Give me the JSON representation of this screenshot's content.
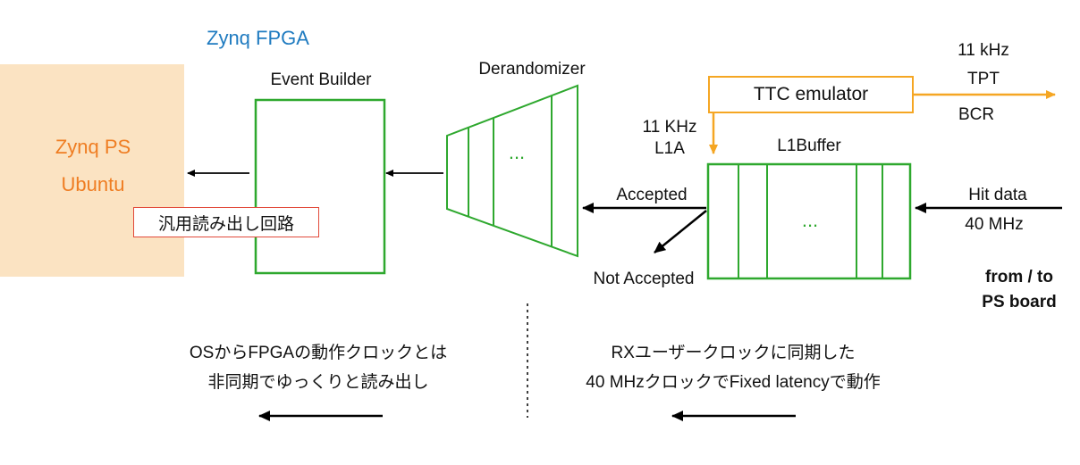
{
  "fpga_title": "Zynq FPGA",
  "zynq_ps": {
    "line1": "Zynq PS",
    "line2": "Ubuntu"
  },
  "readout_circuit": "汎用読み出し回路",
  "event_builder": {
    "label": "Event Builder"
  },
  "derandomizer": {
    "label": "Derandomizer",
    "dots": "..."
  },
  "l1buffer": {
    "label": "L1Buffer",
    "dots": "..."
  },
  "ttc_emulator": {
    "label": "TTC emulator"
  },
  "ttc_output": {
    "freq": "11 kHz",
    "tpt": "TPT",
    "bcr": "BCR"
  },
  "l1a": {
    "freq": "11 KHz",
    "label": "L1A"
  },
  "decision": {
    "accepted": "Accepted",
    "not_accepted": "Not Accepted"
  },
  "hit_data": {
    "label": "Hit data",
    "freq": "40 MHz"
  },
  "ps_board": {
    "line1": "from / to",
    "line2": "PS board"
  },
  "left_note": {
    "line1": "OSからFPGAの動作クロックとは",
    "line2": "非同期でゆっくりと読み出し"
  },
  "right_note": {
    "line1": "RXユーザークロックに同期した",
    "line2": "40 MHzクロックでFixed latencyで動作"
  },
  "colors": {
    "fpga_title": "#1f7bc0",
    "ps_text": "#ef7d22",
    "ps_background": "#fbe3c2",
    "green_box": "#2ea82e",
    "ttc_orange": "#f5a623",
    "readout_border": "#e24a3b"
  }
}
